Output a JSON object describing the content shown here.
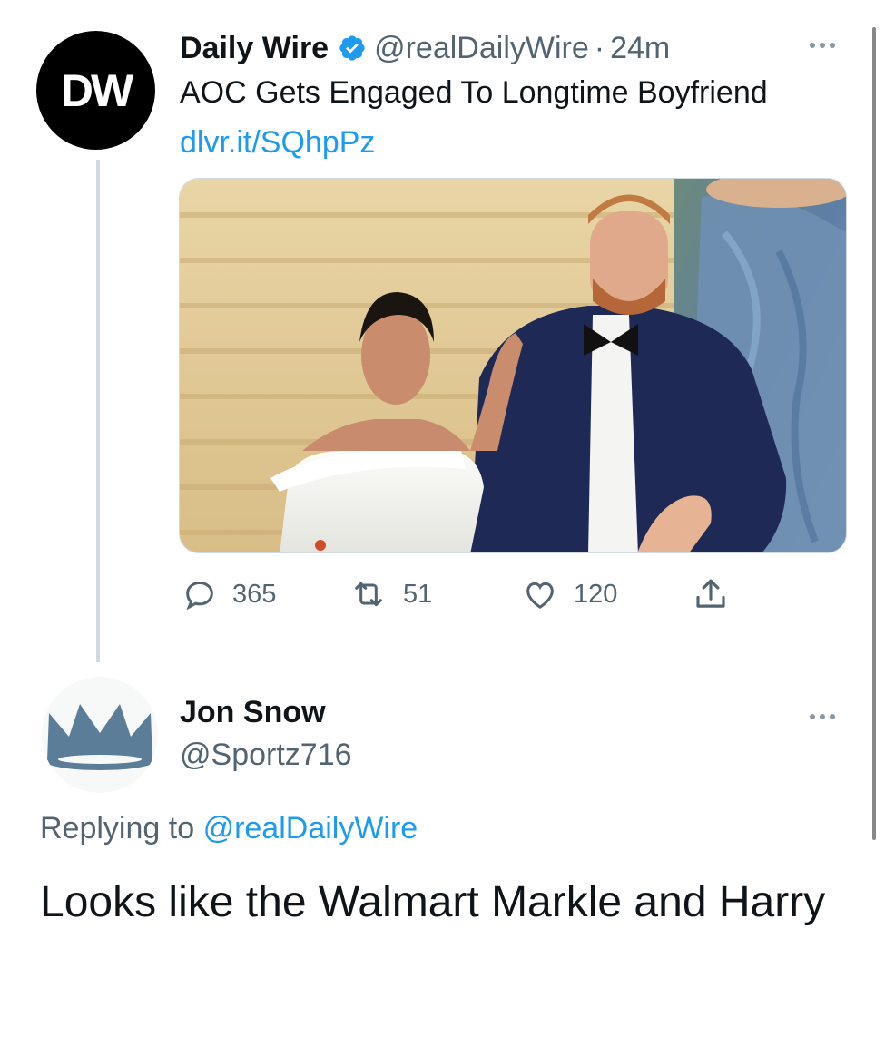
{
  "original_tweet": {
    "avatar_text": "DW",
    "display_name": "Daily Wire",
    "handle": "@realDailyWire",
    "separator": "·",
    "time": "24m",
    "text": "AOC Gets Engaged To Longtime Boyfriend",
    "link": "dlvr.it/SQhpPz",
    "media_icon": "photo-image",
    "actions": {
      "replies": "365",
      "retweets": "51",
      "likes": "120"
    }
  },
  "reply_tweet": {
    "avatar_icon": "crown-icon",
    "display_name": "Jon Snow",
    "handle": "@Sportz716",
    "replying_prefix": "Replying to",
    "replying_to": "@realDailyWire",
    "text": "Looks like the Walmart Markle and Harry"
  },
  "colors": {
    "link_blue": "#1d9bf0",
    "secondary_text": "#536471",
    "primary_text": "#0f1419",
    "crown": "#5b7d98"
  }
}
